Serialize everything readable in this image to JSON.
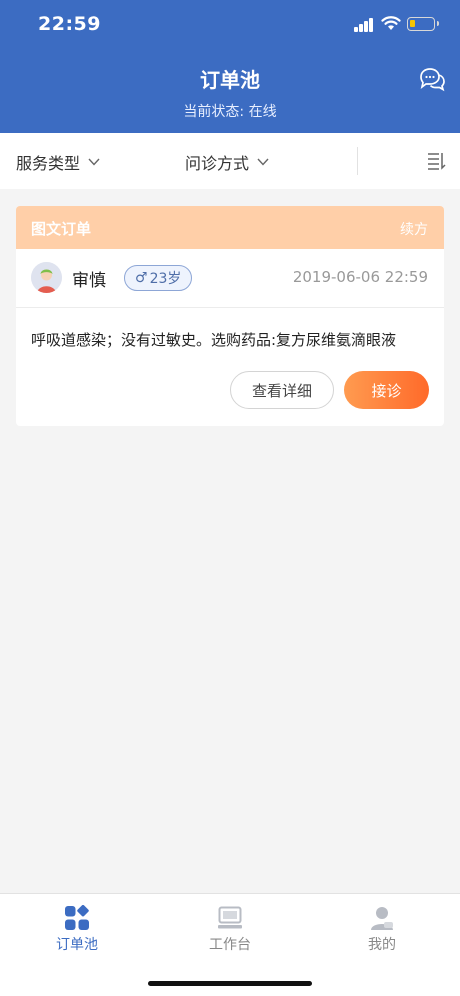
{
  "status_bar": {
    "time": "22:59"
  },
  "header": {
    "title": "订单池",
    "status_text": "当前状态: 在线"
  },
  "filters": {
    "service_type": "服务类型",
    "consult_method": "问诊方式"
  },
  "order": {
    "type_label": "图文订单",
    "tag": "续方",
    "patient_name": "审慎",
    "gender_symbol": "♂",
    "age": "23岁",
    "time": "2019-06-06 22:59",
    "description": "呼吸道感染；没有过敏史。选购药品:复方尿维氨滴眼液",
    "detail_button": "查看详细",
    "accept_button": "接诊"
  },
  "tabs": [
    {
      "label": "订单池",
      "active": true
    },
    {
      "label": "工作台",
      "active": false
    },
    {
      "label": "我的",
      "active": false
    }
  ],
  "colors": {
    "primary": "#3c6cc2",
    "accent": "#ff7a35",
    "card_header": "#ffcfa8"
  }
}
